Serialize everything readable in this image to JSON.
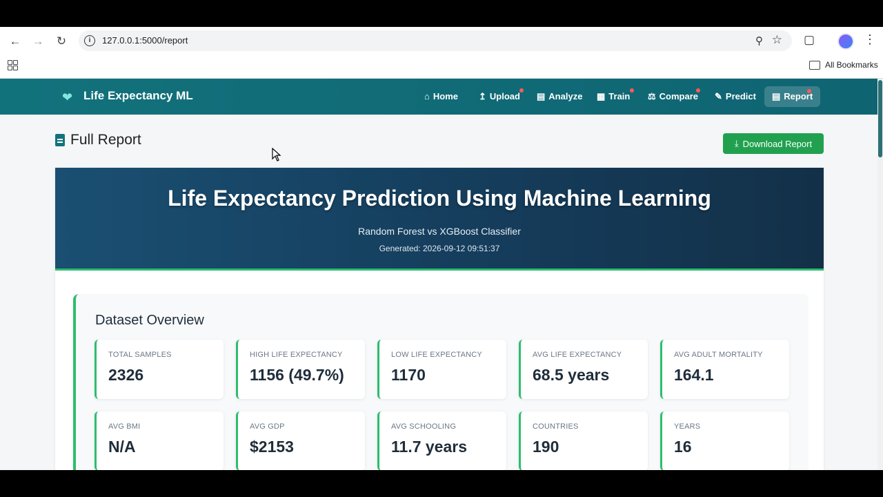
{
  "browser": {
    "url": "127.0.0.1:5000/report",
    "bookmarks_label": "All Bookmarks"
  },
  "navbar": {
    "brand": "Life Expectancy ML",
    "items": [
      {
        "label": "Home",
        "icon": "home-icon",
        "badge": false
      },
      {
        "label": "Upload",
        "icon": "upload-icon",
        "badge": true
      },
      {
        "label": "Analyze",
        "icon": "chart-icon",
        "badge": false
      },
      {
        "label": "Train",
        "icon": "robot-icon",
        "badge": true
      },
      {
        "label": "Compare",
        "icon": "balance-scale-icon",
        "badge": true
      },
      {
        "label": "Predict",
        "icon": "pencil-icon",
        "badge": false
      },
      {
        "label": "Report",
        "icon": "document-icon",
        "badge": true,
        "active": true
      }
    ]
  },
  "page": {
    "title": "Full Report",
    "download_label": "Download Report"
  },
  "report": {
    "title": "Life Expectancy Prediction Using Machine Learning",
    "subtitle": "Random Forest vs XGBoost Classifier",
    "generated": "Generated: 2026-09-12 09:51:37"
  },
  "overview": {
    "title": "Dataset Overview",
    "stats": [
      {
        "label": "Total Samples",
        "value": "2326"
      },
      {
        "label": "High Life Expectancy",
        "value": "1156 (49.7%)"
      },
      {
        "label": "Low Life Expectancy",
        "value": "1170"
      },
      {
        "label": "Avg Life Expectancy",
        "value": "68.5 years"
      },
      {
        "label": "Avg Adult Mortality",
        "value": "164.1"
      },
      {
        "label": "Avg BMI",
        "value": "N/A"
      },
      {
        "label": "Avg GDP",
        "value": "$2153"
      },
      {
        "label": "Avg Schooling",
        "value": "11.7 years"
      },
      {
        "label": "Countries",
        "value": "190"
      },
      {
        "label": "Years",
        "value": "16"
      }
    ]
  },
  "colors": {
    "navbar": "#12727c",
    "accent_green": "#2dbd6e",
    "download_button": "#21a14f",
    "hero_dark": "#153d5c",
    "badge_dot": "#ff5a5a"
  }
}
